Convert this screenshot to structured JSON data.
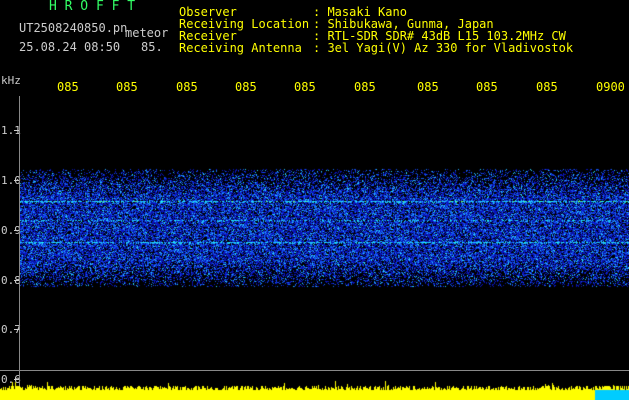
{
  "header": {
    "app_name": "H R O F F T",
    "file_name": "UT2508240850.pn",
    "subtitle": "meteor",
    "datetime": "25.08.24 08:50",
    "frequency_short": "85."
  },
  "station_info": [
    {
      "label": "Observer",
      "value": ": Masaki Kano"
    },
    {
      "label": "Receiving Location",
      "value": ": Shibukawa, Gunma, Japan"
    },
    {
      "label": "Receiver",
      "value": ": RTL-SDR SDR# 43dB L15 103.2MHz CW"
    },
    {
      "label": "Receiving Antenna",
      "value": ": 3el Yagi(V) Az 330 for Vladivostok"
    }
  ],
  "x_axis": {
    "ticks": [
      "085",
      "085",
      "085",
      "085",
      "085",
      "085",
      "085",
      "085",
      "085",
      "0900"
    ]
  },
  "y_axis": {
    "unit": "kHz",
    "ticks": [
      "1.1",
      "1.0",
      "0.9",
      "0.8",
      "0.7",
      "0.6"
    ]
  },
  "colors": {
    "label_yellow": "#ffff00",
    "title_green": "#33ff66",
    "noise_blue": "#1a3cff",
    "signal_cyan": "#40e0ff",
    "bar_yellow": "#ffff00",
    "bar_cyan": "#00ccff"
  },
  "spectrogram": {
    "band_low_khz": 0.785,
    "band_high_khz": 1.02,
    "carrier_lines_khz": [
      0.957,
      0.875,
      0.92
    ],
    "y_range_khz": [
      0.6,
      1.1
    ]
  }
}
